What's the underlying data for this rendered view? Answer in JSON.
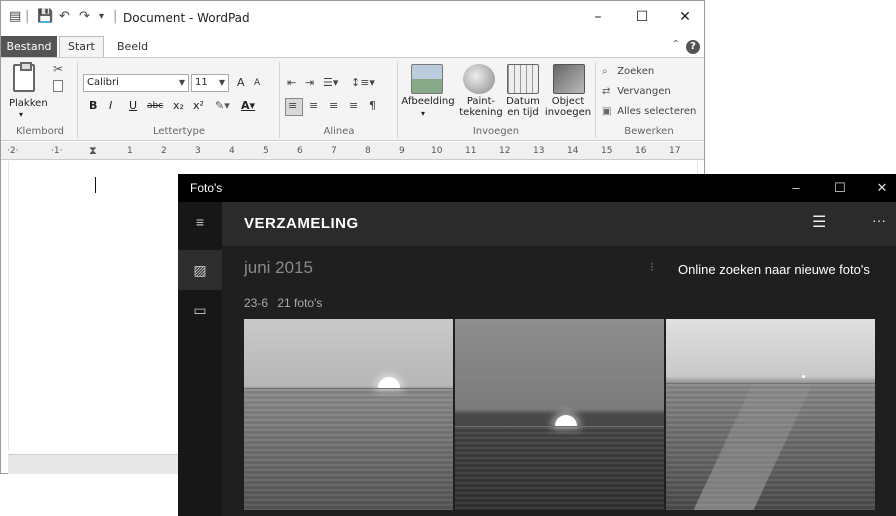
{
  "wordpad": {
    "title": "Document - WordPad",
    "window_controls": {
      "minimize": "–",
      "maximize": "☐",
      "close": "✕"
    },
    "quick_access": {
      "app_icon": "document-icon",
      "separator": "|",
      "save": "save-icon",
      "undo": "undo-icon",
      "redo": "redo-icon",
      "customize": "dropdown-icon"
    },
    "tabs": {
      "file": "Bestand",
      "home": "Start",
      "view": "Beeld"
    },
    "help": "?",
    "clipboard": {
      "paste": "Plakken",
      "group": "Klembord"
    },
    "font": {
      "name": "Calibri",
      "size": "11",
      "group": "Lettertype",
      "bold": "B",
      "italic": "I",
      "underline": "U",
      "strike": "abc",
      "sub": "x₂",
      "super": "x²",
      "grow": "A",
      "shrink": "A"
    },
    "paragraph": {
      "group": "Alinea"
    },
    "insert": {
      "group": "Invoegen",
      "picture": "Afbeelding",
      "paint_line1": "Paint-",
      "paint_line2": "tekening",
      "datetime_line1": "Datum",
      "datetime_line2": "en tijd",
      "object_line1": "Object",
      "object_line2": "invoegen"
    },
    "editing": {
      "group": "Bewerken",
      "find": "Zoeken",
      "replace": "Vervangen",
      "select_all": "Alles selecteren"
    },
    "ruler": {
      "marks": [
        "·2·",
        "·1·",
        "1",
        "2",
        "3",
        "4",
        "5",
        "6",
        "7",
        "8",
        "9",
        "10",
        "11",
        "12",
        "13",
        "14",
        "15",
        "16",
        "17"
      ]
    }
  },
  "photos": {
    "app_title": "Foto's",
    "window_controls": {
      "minimize": "–",
      "maximize": "☐",
      "close": "✕"
    },
    "heading": "VERZAMELING",
    "rail": {
      "hamburger": "≡",
      "collection": "collection-icon",
      "albums": "albums-icon"
    },
    "month": "juni 2015",
    "online_search": "Online zoeken naar nieuwe foto's",
    "date": "23-6",
    "count": "21 foto's",
    "select_icon": "select-list-icon",
    "more": "···",
    "photos": [
      {
        "name": "sunset-over-sea-1"
      },
      {
        "name": "sunset-over-sea-2"
      },
      {
        "name": "ship-wake-sea"
      }
    ]
  }
}
